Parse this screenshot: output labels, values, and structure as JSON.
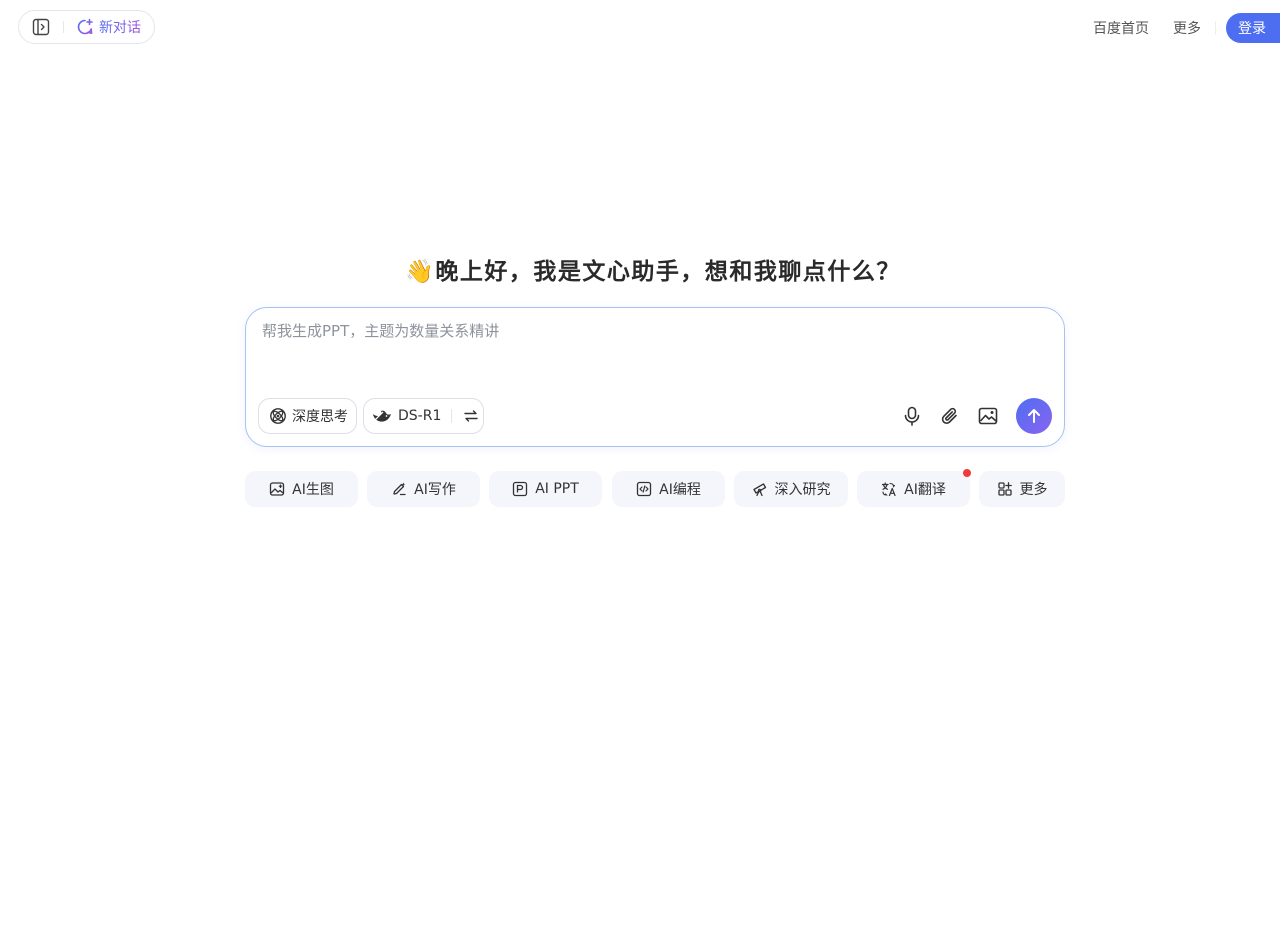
{
  "header": {
    "new_chat_label": "新对话",
    "links": [
      "百度首页",
      "更多"
    ],
    "login_label": "登录"
  },
  "greeting": {
    "emoji": "👋",
    "text": "晚上好，我是文心助手，想和我聊点什么？"
  },
  "composer": {
    "placeholder": "帮我生成PPT，主题为数量关系精讲",
    "deep_think_label": "深度思考",
    "model_label": "DS-R1"
  },
  "quick_actions": [
    {
      "label": "AI生图",
      "icon": "image-gen-icon"
    },
    {
      "label": "AI写作",
      "icon": "pen-icon"
    },
    {
      "label": "AI PPT",
      "icon": "ppt-icon"
    },
    {
      "label": "AI编程",
      "icon": "code-icon"
    },
    {
      "label": "深入研究",
      "icon": "telescope-icon"
    },
    {
      "label": "AI翻译",
      "icon": "translate-icon"
    },
    {
      "label": "更多",
      "icon": "apps-icon"
    }
  ],
  "colors": {
    "accent": "#4e6ef2",
    "accent_purple": "#a357e0",
    "chip_bg": "#f4f6fc",
    "notification_dot": "#f03a3a"
  }
}
